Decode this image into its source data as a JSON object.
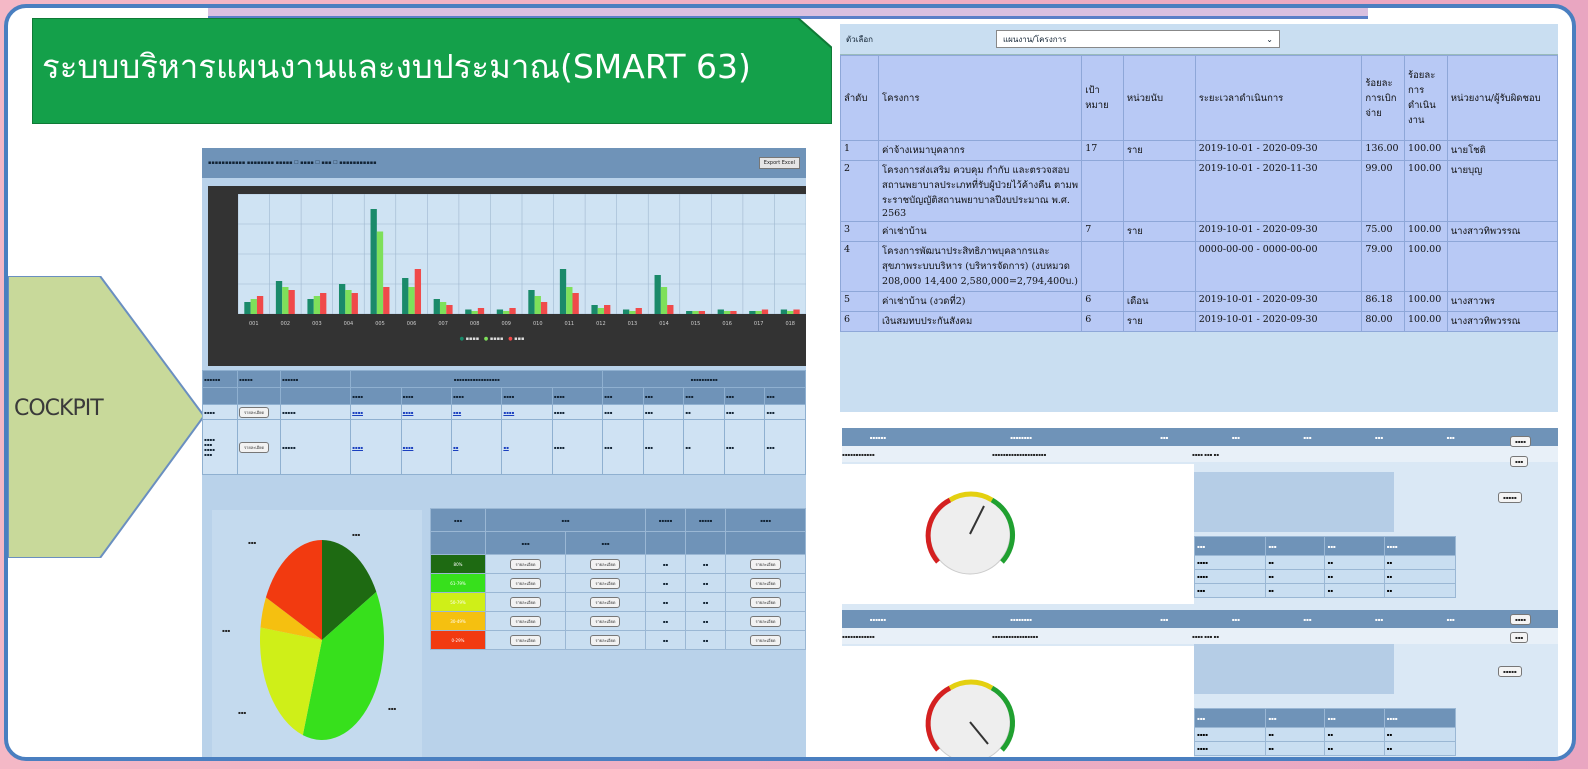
{
  "title": "ระบบบริหารแผนงานและงบประมาณ(SMART  63)",
  "cockpit_label": "COCKPIT",
  "colors": {
    "banner": "#14a04a",
    "cockpit": "#c8d99a",
    "frame": "#4a7fc0"
  },
  "right_table": {
    "select_label": "ตัวเลือก",
    "select_value": "แผนงาน/โครงการ",
    "headers": [
      "ลำดับ",
      "โครงการ",
      "เป้าหมาย",
      "หน่วยนับ",
      "ระยะเวลาดำเนินการ",
      "ร้อยละการเบิกจ่าย",
      "ร้อยละการดำเนินงาน",
      "หน่วยงาน/ผู้รับผิดชอบ"
    ],
    "rows": [
      {
        "no": "1",
        "project": "ค่าจ้างเหมาบุคลากร",
        "target": "17",
        "unit": "ราย",
        "period": "2019-10-01 - 2020-09-30",
        "pct1": "136.00",
        "pct2": "100.00",
        "owner": "นายโชติ"
      },
      {
        "no": "2",
        "project": "โครงการส่งเสริม ควบคุม กำกับ และตรวจสอบสถานพยาบาลประเภทที่รับผู้ป่วยไว้ค้างคืน ตามพระราชบัญญัติสถานพยาบาลปีงบประมาณ พ.ศ. 2563",
        "target": "",
        "unit": "",
        "period": "2019-10-01 - 2020-11-30",
        "pct1": "99.00",
        "pct2": "100.00",
        "owner": "นายบุญ"
      },
      {
        "no": "3",
        "project": "ค่าเช่าบ้าน",
        "target": "7",
        "unit": "ราย",
        "period": "2019-10-01 - 2020-09-30",
        "pct1": "75.00",
        "pct2": "100.00",
        "owner": "นางสาวทิพวรรณ"
      },
      {
        "no": "4",
        "project": "โครงการพัฒนาประสิทธิภาพบุคลากรและสุขภาพระบบบริหาร (บริหารจัดการ) (งบหมวด 208,000 14,400 2,580,000=2,794,400บ.)",
        "target": "",
        "unit": "",
        "period": "0000-00-00 - 0000-00-00",
        "pct1": "79.00",
        "pct2": "100.00",
        "owner": ""
      },
      {
        "no": "5",
        "project": "ค่าเช่าบ้าน (งวดที่2)",
        "target": "6",
        "unit": "เดือน",
        "period": "2019-10-01 - 2020-09-30",
        "pct1": "86.18",
        "pct2": "100.00",
        "owner": "นางสาวพร"
      },
      {
        "no": "6",
        "project": "เงินสมทบประกันสังคม",
        "target": "6",
        "unit": "ราย",
        "period": "2019-10-01 - 2020-09-30",
        "pct1": "80.00",
        "pct2": "100.00",
        "owner": "นางสาวทิพวรรณ"
      }
    ]
  },
  "left_shot": {
    "export_btn": "Export Excel",
    "detail_btn": "รายละเอียด",
    "chart_data": {
      "type": "bar",
      "categories": [
        "001",
        "002",
        "003",
        "004",
        "005",
        "006",
        "007",
        "008",
        "009",
        "010",
        "011",
        "012",
        "013",
        "014",
        "015",
        "016",
        "017",
        "018"
      ],
      "series": [
        {
          "name": "",
          "color": "#1a8a6a",
          "values": [
            8,
            22,
            10,
            20,
            70,
            24,
            10,
            3,
            3,
            16,
            30,
            6,
            3,
            26,
            2,
            3,
            2,
            3
          ]
        },
        {
          "name": "",
          "color": "#7ee05a",
          "values": [
            10,
            18,
            12,
            16,
            55,
            18,
            8,
            2,
            2,
            12,
            18,
            4,
            2,
            18,
            2,
            2,
            2,
            2
          ]
        },
        {
          "name": "",
          "color": "#f04a4a",
          "values": [
            12,
            16,
            14,
            14,
            18,
            30,
            6,
            4,
            4,
            8,
            14,
            6,
            4,
            6,
            2,
            2,
            3,
            3
          ]
        }
      ]
    },
    "pie": {
      "slices": [
        {
          "value": 17,
          "color": "#1e6a12"
        },
        {
          "value": 38,
          "color": "#37e01c"
        },
        {
          "value": 22,
          "color": "#cfef18"
        },
        {
          "value": 5,
          "color": "#f5c010"
        },
        {
          "value": 18,
          "color": "#f23a10"
        }
      ]
    },
    "status_rows": [
      {
        "pct": "80%",
        "color": "#1e6a12"
      },
      {
        "pct": "61-79%",
        "color": "#37e01c"
      },
      {
        "pct": "50-79%",
        "color": "#cfef18"
      },
      {
        "pct": "30-49%",
        "color": "#f5c010"
      },
      {
        "pct": "0-29%",
        "color": "#f23a10"
      }
    ]
  }
}
